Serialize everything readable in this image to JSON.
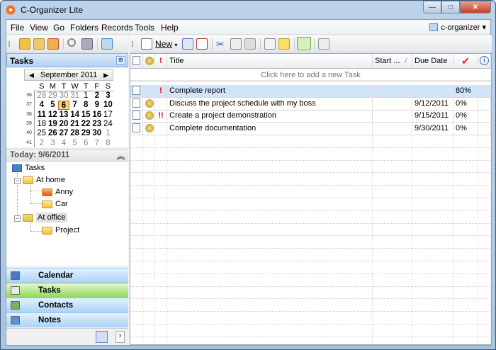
{
  "window": {
    "title": "C-Organizer Lite",
    "minimize": "—",
    "maximize": "□",
    "close": "✕"
  },
  "menu": [
    "File",
    "View",
    "Go",
    "Folders",
    "Records",
    "Tools",
    "Help"
  ],
  "account": {
    "label": "c-organizer ▾",
    "icon": "account-icon"
  },
  "toolbar": {
    "new_label": "New",
    "new_arrow": "▾"
  },
  "panel": {
    "title": "Tasks",
    "pin": "⊞"
  },
  "calendar": {
    "month": "September 2011",
    "prev": "◀",
    "next": "▶",
    "dow": [
      "S",
      "M",
      "T",
      "W",
      "T",
      "F",
      "S"
    ],
    "weeks": [
      {
        "num": "36",
        "days": [
          [
            "28",
            "g"
          ],
          [
            "29",
            "g"
          ],
          [
            "30",
            "g"
          ],
          [
            "31",
            "g"
          ],
          [
            "1",
            ""
          ],
          [
            "2",
            "b"
          ],
          [
            "3",
            "b"
          ]
        ]
      },
      {
        "num": "37",
        "days": [
          [
            "4",
            "b"
          ],
          [
            "5",
            "b"
          ],
          [
            "6",
            "b today"
          ],
          [
            "7",
            "b"
          ],
          [
            "8",
            "b"
          ],
          [
            "9",
            "b"
          ],
          [
            "10",
            "b"
          ]
        ]
      },
      {
        "num": "38",
        "days": [
          [
            "11",
            "b"
          ],
          [
            "12",
            "b"
          ],
          [
            "13",
            "b"
          ],
          [
            "14",
            "b"
          ],
          [
            "15",
            "b"
          ],
          [
            "16",
            "b"
          ],
          [
            "17",
            ""
          ]
        ]
      },
      {
        "num": "39",
        "days": [
          [
            "18",
            ""
          ],
          [
            "19",
            "b"
          ],
          [
            "20",
            "b"
          ],
          [
            "21",
            "b"
          ],
          [
            "22",
            "b"
          ],
          [
            "23",
            "b"
          ],
          [
            "24",
            ""
          ]
        ]
      },
      {
        "num": "40",
        "days": [
          [
            "25",
            ""
          ],
          [
            "26",
            "b"
          ],
          [
            "27",
            "b"
          ],
          [
            "28",
            "b"
          ],
          [
            "29",
            "b"
          ],
          [
            "30",
            "b"
          ],
          [
            "1",
            "g"
          ]
        ]
      },
      {
        "num": "41",
        "days": [
          [
            "2",
            "g"
          ],
          [
            "3",
            "g"
          ],
          [
            "4",
            "g"
          ],
          [
            "5",
            "g"
          ],
          [
            "6",
            "g"
          ],
          [
            "7",
            "g"
          ],
          [
            "8",
            "g"
          ]
        ]
      }
    ]
  },
  "today": {
    "label": "Today: 9/6/2011",
    "collapse": "︽"
  },
  "tree": {
    "root": "Tasks",
    "home": "At home",
    "anny": "Anny",
    "car": "Car",
    "office": "At office",
    "project": "Project",
    "expanded": "−"
  },
  "nav": [
    {
      "label": "Calendar",
      "color": "#4a78c8"
    },
    {
      "label": "Tasks",
      "color": "#e8e8e8"
    },
    {
      "label": "Contacts",
      "color": "#7ab060"
    },
    {
      "label": "Notes",
      "color": "#5a90d8"
    }
  ],
  "navfoot": {
    "more": "›"
  },
  "grid": {
    "headers": {
      "priority": "!",
      "title": "Title",
      "start": "Start ...",
      "sort": "/",
      "due": "Due Date",
      "complete": "✔",
      "info": "i"
    },
    "add_row": "Click here to add a new Task",
    "rows": [
      {
        "reminder": false,
        "priority": "!",
        "title": "Complete report",
        "start": "",
        "due": "",
        "complete": "80%"
      },
      {
        "reminder": true,
        "priority": "",
        "title": "Discuss the project schedule with my boss",
        "start": "",
        "due": "9/12/2011",
        "complete": "0%"
      },
      {
        "reminder": true,
        "priority": "!!",
        "title": "Create a project demonstration",
        "start": "",
        "due": "9/15/2011",
        "complete": "0%"
      },
      {
        "reminder": true,
        "priority": "",
        "title": "Complete documentation",
        "start": "",
        "due": "9/30/2011",
        "complete": "0%"
      }
    ]
  }
}
